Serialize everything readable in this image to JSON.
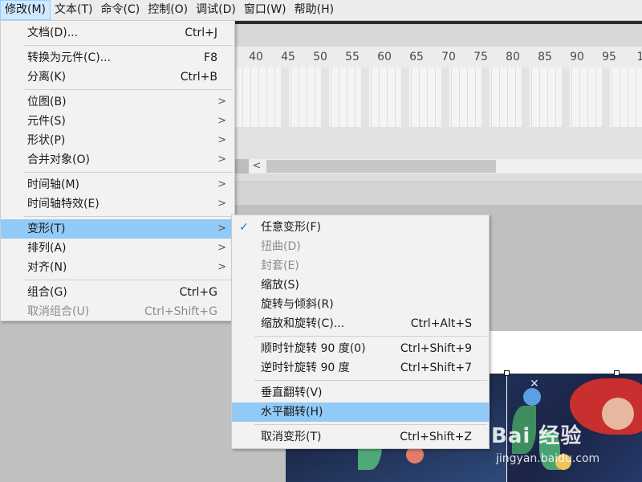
{
  "menubar": [
    {
      "label": "修改(M)",
      "active": true
    },
    {
      "label": "文本(T)"
    },
    {
      "label": "命令(C)"
    },
    {
      "label": "控制(O)"
    },
    {
      "label": "调试(D)"
    },
    {
      "label": "窗口(W)"
    },
    {
      "label": "帮助(H)"
    }
  ],
  "ruler": [
    "40",
    "45",
    "50",
    "55",
    "60",
    "65",
    "70",
    "75",
    "80",
    "85",
    "90",
    "95",
    "1"
  ],
  "hscroll": {
    "left_arrow": "<"
  },
  "modify_menu": {
    "document": {
      "label": "文档(D)...",
      "shortcut": "Ctrl+J"
    },
    "convert_symbol": {
      "label": "转换为元件(C)...",
      "shortcut": "F8"
    },
    "break_apart": {
      "label": "分离(K)",
      "shortcut": "Ctrl+B"
    },
    "bitmap": {
      "label": "位图(B)"
    },
    "symbol": {
      "label": "元件(S)"
    },
    "shape": {
      "label": "形状(P)"
    },
    "combine": {
      "label": "合并对象(O)"
    },
    "timeline": {
      "label": "时间轴(M)"
    },
    "timeline_effects": {
      "label": "时间轴特效(E)"
    },
    "transform": {
      "label": "变形(T)"
    },
    "arrange": {
      "label": "排列(A)"
    },
    "align": {
      "label": "对齐(N)"
    },
    "group": {
      "label": "组合(G)",
      "shortcut": "Ctrl+G"
    },
    "ungroup": {
      "label": "取消组合(U)",
      "shortcut": "Ctrl+Shift+G"
    },
    "submenu_arrow": ">"
  },
  "transform_menu": {
    "check": "✓",
    "free_transform": {
      "label": "任意变形(F)"
    },
    "distort": {
      "label": "扭曲(D)"
    },
    "envelope": {
      "label": "封套(E)"
    },
    "scale": {
      "label": "缩放(S)"
    },
    "rotate_skew": {
      "label": "旋转与倾斜(R)"
    },
    "scale_rotate": {
      "label": "缩放和旋转(C)...",
      "shortcut": "Ctrl+Alt+S"
    },
    "rotate_cw": {
      "label": "顺时针旋转 90 度(0)",
      "shortcut": "Ctrl+Shift+9"
    },
    "rotate_ccw": {
      "label": "逆时针旋转 90 度",
      "shortcut": "Ctrl+Shift+7"
    },
    "flip_vertical": {
      "label": "垂直翻转(V)"
    },
    "flip_horizontal": {
      "label": "水平翻转(H)"
    },
    "remove_transform": {
      "label": "取消变形(T)",
      "shortcut": "Ctrl+Shift+Z"
    }
  },
  "watermark": {
    "brand": "Bai 经验",
    "url": "jingyan.baidu.com"
  },
  "colors": {
    "menu_highlight": "#91c9f7",
    "menubar_active": "#cde8ff"
  }
}
